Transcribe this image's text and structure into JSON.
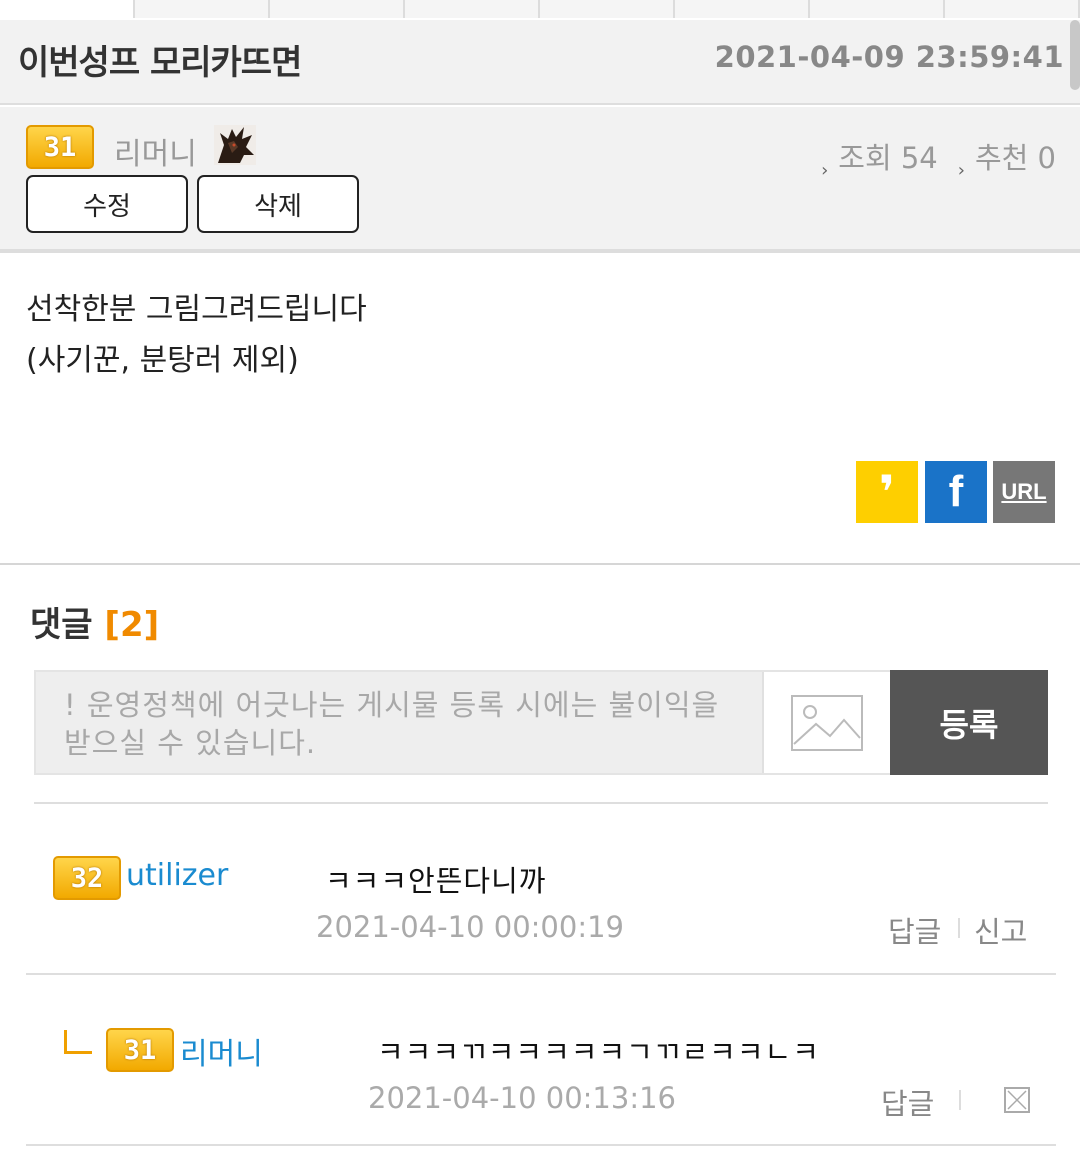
{
  "post": {
    "title": "이번성프 모리카뜨면",
    "date": "2021-04-09 23:59:41",
    "author": {
      "level": "31",
      "name": "리머니"
    },
    "views_label": "조회 54",
    "recommend_label": "추천 0",
    "edit_label": "수정",
    "delete_label": "삭제",
    "body_lines": [
      "선착한분 그림그려드립니다",
      "(사기꾼, 분탕러 제외)"
    ]
  },
  "share": {
    "kakao_glyph": "❜",
    "facebook_glyph": "f",
    "url_label": "URL"
  },
  "comments": {
    "heading": "댓글",
    "count": "[2]",
    "placeholder": "! 운영정책에 어긋나는 게시물 등록 시에는 불이익을 받으실 수 있습니다.",
    "submit_label": "등록",
    "items": [
      {
        "level": "32",
        "name": "utilizer",
        "text": "ㅋㅋㅋ안뜬다니까",
        "date": "2021-04-10 00:00:19",
        "reply_label": "답글",
        "report_label": "신고"
      },
      {
        "level": "31",
        "name": "리머니",
        "text": "ㅋㅋㅋㄲㅋㅋㅋㅋㅋㄱㄲㄹㅋㅋㄴㅋ",
        "date": "2021-04-10 00:13:16",
        "reply_label": "답글"
      }
    ]
  },
  "icons": [
    "kakao-icon",
    "facebook-icon",
    "url-icon",
    "image-upload-icon",
    "reply-arrow-icon",
    "delete-x-icon"
  ],
  "colors": {
    "level_badge": "#f2a900",
    "username": "#1a8bd0",
    "count": "#f08a00",
    "kakao": "#fecf00",
    "facebook": "#1a73c8",
    "submit": "#555555"
  }
}
